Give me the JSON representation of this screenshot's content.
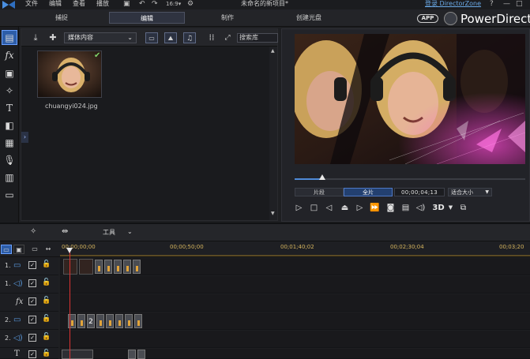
{
  "menu": {
    "items": [
      "文件",
      "编辑",
      "查看",
      "播放"
    ],
    "project_title": "未命名的新项目*",
    "login_link": "登录 DirectorZone",
    "help": "?",
    "minimize": "—",
    "maximize": "□",
    "close": "×"
  },
  "modes": {
    "tabs": [
      "捕捉",
      "编辑",
      "制作",
      "创建光盘"
    ],
    "active": "编辑",
    "app_badge": "APP",
    "brand": "PowerDirector"
  },
  "library": {
    "content_dropdown": "媒体内容",
    "search_placeholder": "搜索库",
    "media": [
      {
        "filename": "chuangyi024.jpg",
        "checked": true
      }
    ]
  },
  "preview": {
    "tab_clip": "片段",
    "tab_movie": "全片",
    "active_tab": "全片",
    "timecode": "00;00;04;13",
    "fit_select": "适合大小",
    "playback_progress": 0.12,
    "three_d_label": "3D"
  },
  "timeline": {
    "tools_label": "工具",
    "ruler_ticks": [
      "00;00;00;00",
      "00;00;50;00",
      "00;01;40;02",
      "00;02;30;04",
      "00;03;20"
    ],
    "tracks": [
      {
        "num": "1.",
        "type": "video-icon"
      },
      {
        "num": "1.",
        "type": "audio-icon"
      },
      {
        "num": "",
        "type": "fx-icon",
        "label": "fx"
      },
      {
        "num": "2.",
        "type": "video-icon"
      },
      {
        "num": "2.",
        "type": "audio-icon"
      },
      {
        "num": "",
        "type": "title-icon"
      }
    ],
    "clip_number": "2"
  },
  "colors": {
    "accent": "#2d5da8",
    "ruler_text": "#d5b45e",
    "playhead": "#dd3333"
  }
}
